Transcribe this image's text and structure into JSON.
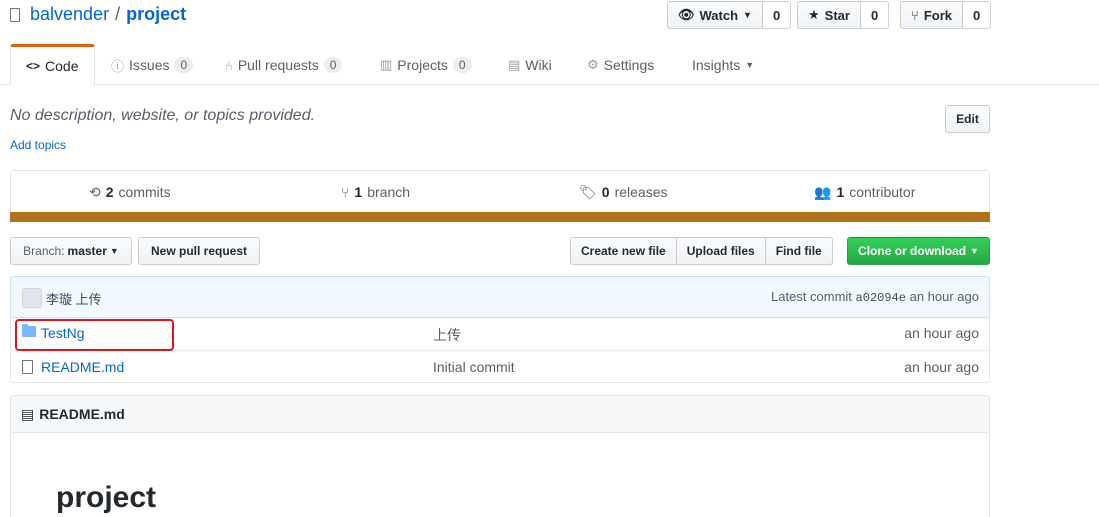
{
  "repo": {
    "owner": "balvender",
    "separator": "/",
    "name": "project"
  },
  "actions": {
    "watch": {
      "label": "Watch",
      "count": "0"
    },
    "star": {
      "label": "Star",
      "count": "0"
    },
    "fork": {
      "label": "Fork",
      "count": "0"
    }
  },
  "tabs": [
    {
      "label": "Code",
      "badge": ""
    },
    {
      "label": "Issues",
      "badge": "0"
    },
    {
      "label": "Pull requests",
      "badge": "0"
    },
    {
      "label": "Projects",
      "badge": "0"
    },
    {
      "label": "Wiki",
      "badge": ""
    },
    {
      "label": "Settings",
      "badge": ""
    },
    {
      "label": "Insights",
      "badge": ""
    }
  ],
  "description": "No description, website, or topics provided.",
  "add_topics": "Add topics",
  "edit_label": "Edit",
  "summary": {
    "commits": {
      "count": "2",
      "label": "commits"
    },
    "branches": {
      "count": "1",
      "label": "branch"
    },
    "releases": {
      "count": "0",
      "label": "releases"
    },
    "contributors": {
      "count": "1",
      "label": "contributor"
    },
    "language_color": "#b07219"
  },
  "file_nav": {
    "branch_label": "Branch:",
    "branch_value": "master",
    "new_pr": "New pull request",
    "create_file": "Create new file",
    "upload_files": "Upload files",
    "find_file": "Find file",
    "clone": "Clone or download"
  },
  "latest_commit": {
    "author_message": "李璇 上传",
    "prefix": "Latest commit",
    "sha": "a02094e",
    "age": "an hour ago"
  },
  "files": [
    {
      "name": "TestNg",
      "type": "folder",
      "message": "上传",
      "age": "an hour ago"
    },
    {
      "name": "README.md",
      "type": "file",
      "message": "Initial commit",
      "age": "an hour ago"
    }
  ],
  "readme": {
    "filename": "README.md",
    "heading": "project"
  },
  "colors": {
    "accent_tab": "#e36209",
    "link": "#0366d6",
    "clone_green": "#28a745",
    "highlight_red": "#e5141c"
  }
}
